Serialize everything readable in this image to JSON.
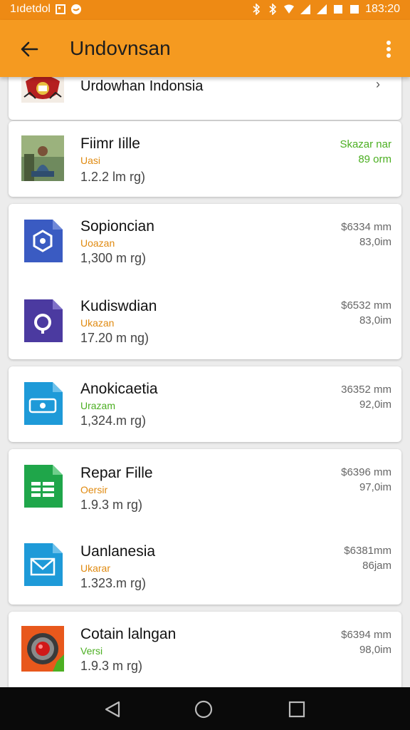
{
  "status_bar": {
    "left_text": "1ıdetdol",
    "time": "183:20"
  },
  "app_bar": {
    "title": "Undovnsan"
  },
  "header_item": {
    "label": "Urdowhan Indonsia",
    "chevron": "›"
  },
  "items": [
    {
      "name": "Fiimr Iille",
      "subtitle": "Uasi",
      "subtitle_color": "#e08a10",
      "size": "1.2.2 lm rg)",
      "meta1": "Skazar nar",
      "meta2": "89 orm",
      "meta_color": "#4caf22",
      "icon": "photo-thumbnail"
    },
    {
      "name": "Sopioncian",
      "subtitle": "Uoazan",
      "subtitle_color": "#e08a10",
      "size": "1,300 m rg)",
      "meta1": "$6334 mm",
      "meta2": "83,0im",
      "meta_color": "#666666",
      "icon": "blue-document-icon"
    },
    {
      "name": "Kudiswdian",
      "subtitle": "Ukazan",
      "subtitle_color": "#e08a10",
      "size": "17.20 m ng)",
      "meta1": "$6532 mm",
      "meta2": "83,0im",
      "meta_color": "#666666",
      "icon": "purple-document-icon"
    },
    {
      "name": "Anokicaetia",
      "subtitle": "Urazam",
      "subtitle_color": "#4caf22",
      "size": "1,324.m rg)",
      "meta1": "36352 mm",
      "meta2": "92,0im",
      "meta_color": "#666666",
      "icon": "lightblue-document-icon"
    },
    {
      "name": "Repar Fille",
      "subtitle": "Oersir",
      "subtitle_color": "#e08a10",
      "size": "1.9.3 m rg)",
      "meta1": "$6396 mm",
      "meta2": "97,0im",
      "meta_color": "#666666",
      "icon": "spreadsheet-icon"
    },
    {
      "name": "Uanlanesia",
      "subtitle": "Ukarar",
      "subtitle_color": "#e08a10",
      "size": "1.323.m rg)",
      "meta1": "$6381mm",
      "meta2": "86jam",
      "meta_color": "#666666",
      "icon": "mail-document-icon"
    },
    {
      "name": "Cotain lalngan",
      "subtitle": "Versi",
      "subtitle_color": "#4caf22",
      "size": "1.9.3 m rg)",
      "meta1": "$6394 mm",
      "meta2": "98,0im",
      "meta_color": "#666666",
      "icon": "app-thumbnail"
    }
  ],
  "colors": {
    "status_bar": "#ee8a14",
    "app_bar": "#f59a20",
    "nav_bar": "#0a0a0a"
  }
}
